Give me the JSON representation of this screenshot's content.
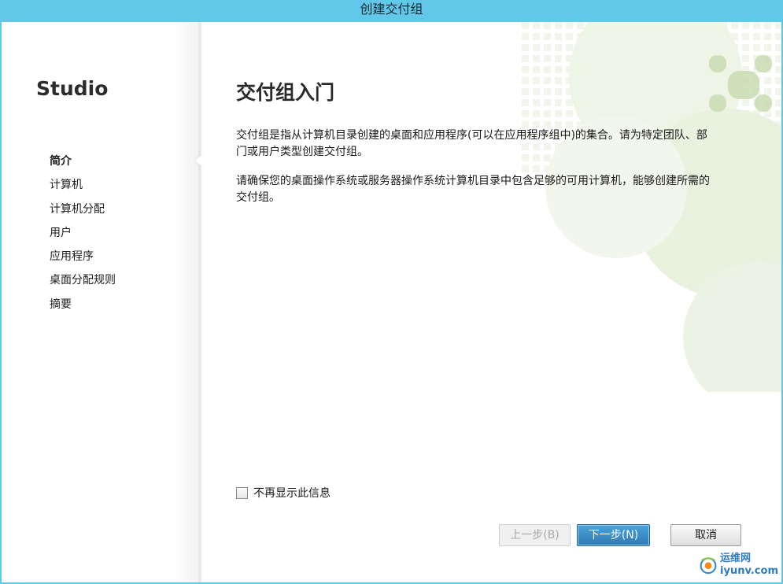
{
  "window": {
    "title": "创建交付组"
  },
  "sidebar": {
    "product": "Studio",
    "items": [
      {
        "label": "简介",
        "active": true
      },
      {
        "label": "计算机",
        "active": false
      },
      {
        "label": "计算机分配",
        "active": false
      },
      {
        "label": "用户",
        "active": false
      },
      {
        "label": "应用程序",
        "active": false
      },
      {
        "label": "桌面分配规则",
        "active": false
      },
      {
        "label": "摘要",
        "active": false
      }
    ]
  },
  "main": {
    "heading": "交付组入门",
    "paragraph1": "交付组是指从计算机目录创建的桌面和应用程序(可以在应用程序组中)的集合。请为特定团队、部门或用户类型创建交付组。",
    "paragraph2": "请确保您的桌面操作系统或服务器操作系统计算机目录中包含足够的可用计算机，能够创建所需的交付组。",
    "dont_show_again": {
      "label": "不再显示此信息",
      "checked": false
    }
  },
  "footer": {
    "back_label": "上一步(B)",
    "back_enabled": false,
    "next_label": "下一步(N)",
    "cancel_label": "取消"
  },
  "watermark": {
    "cn": "运维网",
    "en": "iyunv.com"
  },
  "colors": {
    "titlebar": "#62c8ea",
    "primary_button": "#2f79b4",
    "deco_green": "#c9dcb3"
  }
}
